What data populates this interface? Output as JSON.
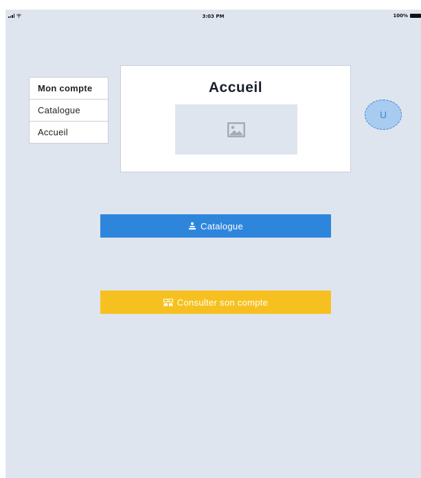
{
  "status_bar": {
    "time": "3:03 PM",
    "battery": "100%",
    "signal_icon": "signal-icon",
    "wifi_icon": "wifi-icon",
    "battery_icon": "battery-icon"
  },
  "menu": {
    "items": [
      {
        "label": "Mon compte",
        "active": true
      },
      {
        "label": "Catalogue",
        "active": false
      },
      {
        "label": "Accueil",
        "active": false
      }
    ]
  },
  "card": {
    "title": "Accueil",
    "image_icon": "image-placeholder-icon"
  },
  "avatar": {
    "initial": "U"
  },
  "buttons": {
    "catalogue": {
      "label": "Catalogue",
      "icon": "catalogue-icon",
      "color": "#2e86dc"
    },
    "account": {
      "label": "Consulter son compte",
      "icon": "account-icon",
      "color": "#f6c120"
    }
  }
}
